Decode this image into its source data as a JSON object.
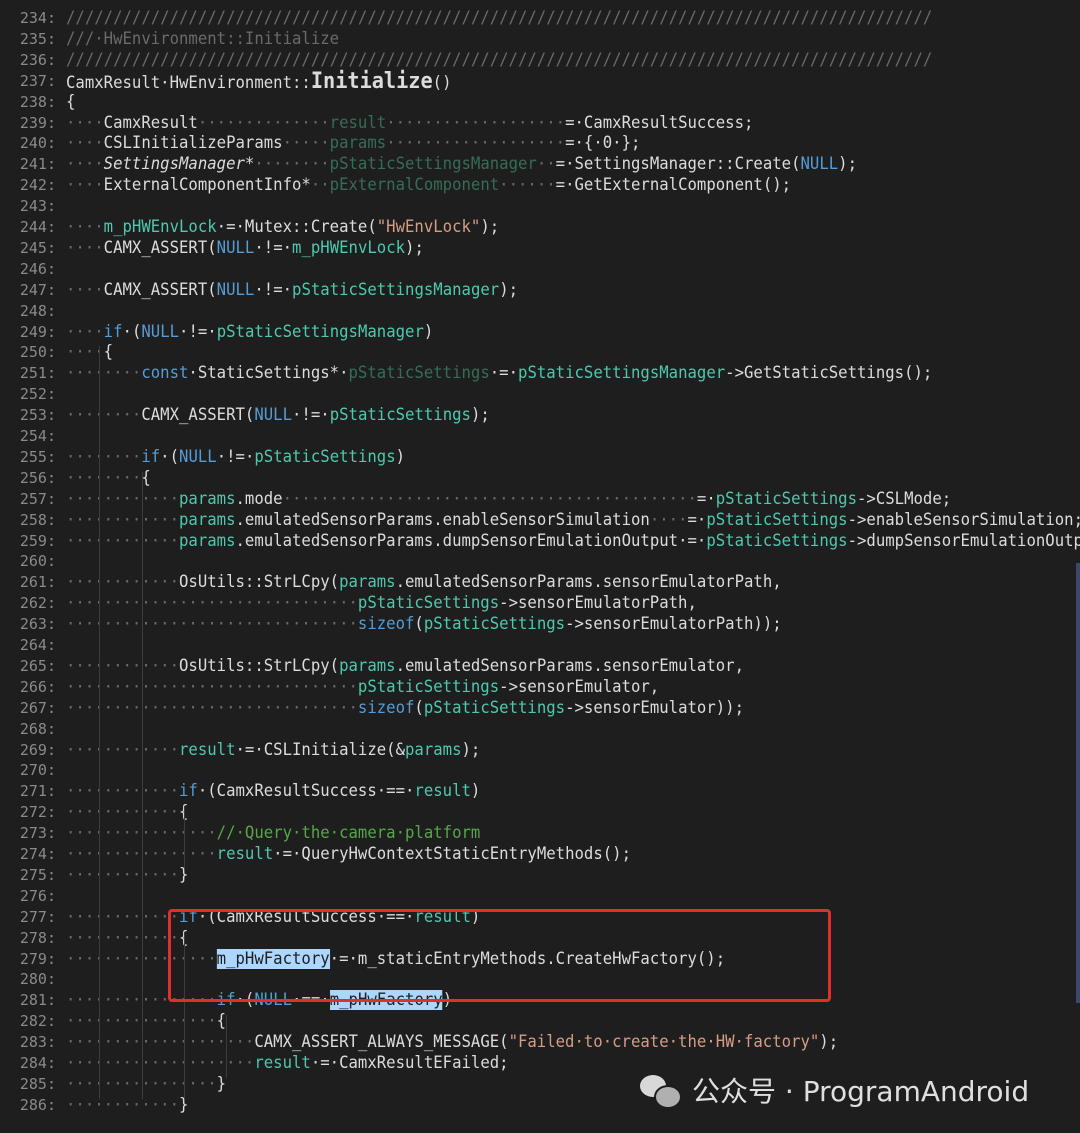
{
  "watermark": {
    "text": "公众号 · ProgramAndroid",
    "icon": "wechat-icon"
  },
  "lines": [
    {
      "n": "234:",
      "s": [
        [
          "dot",
          "////////////////////////////////////////////////////////////////////////////////////////////"
        ]
      ]
    },
    {
      "n": "235:",
      "s": [
        [
          "dot",
          "///·HwEnvironment::Initialize"
        ]
      ]
    },
    {
      "n": "236:",
      "s": [
        [
          "dot",
          "////////////////////////////////////////////////////////////////////////////////////////////"
        ]
      ]
    },
    {
      "n": "237:",
      "s": [
        [
          "plain",
          "CamxResult·HwEnvironment::"
        ],
        [
          "fn",
          "Initialize"
        ],
        [
          "plain",
          "()"
        ]
      ]
    },
    {
      "n": "238:",
      "s": [
        [
          "plain",
          "{"
        ]
      ]
    },
    {
      "n": "239:",
      "s": [
        [
          "dot",
          "····"
        ],
        [
          "plain",
          "CamxResult"
        ],
        [
          "dot",
          "··············"
        ],
        [
          "gray",
          "result"
        ],
        [
          "dot",
          "···················"
        ],
        [
          "plain",
          "=·CamxResultSuccess;"
        ]
      ]
    },
    {
      "n": "240:",
      "s": [
        [
          "dot",
          "····"
        ],
        [
          "plain",
          "CSLInitializeParams"
        ],
        [
          "dot",
          "·····"
        ],
        [
          "gray",
          "params"
        ],
        [
          "dot",
          "···················"
        ],
        [
          "plain",
          "=·{·0·};"
        ]
      ]
    },
    {
      "n": "241:",
      "s": [
        [
          "dot",
          "····"
        ],
        [
          "it",
          "SettingsManager*"
        ],
        [
          "dot",
          "········"
        ],
        [
          "gray",
          "pStaticSettingsManager"
        ],
        [
          "dot",
          "··"
        ],
        [
          "plain",
          "=·SettingsManager::Create("
        ],
        [
          "kw",
          "NULL"
        ],
        [
          "plain",
          ");"
        ]
      ]
    },
    {
      "n": "242:",
      "s": [
        [
          "dot",
          "····"
        ],
        [
          "plain",
          "ExternalComponentInfo*"
        ],
        [
          "dot",
          "··"
        ],
        [
          "gray",
          "pExternalComponent"
        ],
        [
          "dot",
          "······"
        ],
        [
          "plain",
          "=·GetExternalComponent();"
        ]
      ]
    },
    {
      "n": "243:",
      "s": []
    },
    {
      "n": "244:",
      "s": [
        [
          "dot",
          "····"
        ],
        [
          "var",
          "m_pHWEnvLock"
        ],
        [
          "plain",
          "·=·Mutex::Create("
        ],
        [
          "str",
          "\"HwEnvLock\""
        ],
        [
          "plain",
          ");"
        ]
      ]
    },
    {
      "n": "245:",
      "s": [
        [
          "dot",
          "····"
        ],
        [
          "plain",
          "CAMX_ASSERT("
        ],
        [
          "kw",
          "NULL"
        ],
        [
          "plain",
          "·!=·"
        ],
        [
          "var",
          "m_pHWEnvLock"
        ],
        [
          "plain",
          ");"
        ]
      ]
    },
    {
      "n": "246:",
      "s": []
    },
    {
      "n": "247:",
      "s": [
        [
          "dot",
          "····"
        ],
        [
          "plain",
          "CAMX_ASSERT("
        ],
        [
          "kw",
          "NULL"
        ],
        [
          "plain",
          "·!=·"
        ],
        [
          "var",
          "pStaticSettingsManager"
        ],
        [
          "plain",
          ");"
        ]
      ]
    },
    {
      "n": "248:",
      "s": []
    },
    {
      "n": "249:",
      "s": [
        [
          "dot",
          "····"
        ],
        [
          "kw",
          "if"
        ],
        [
          "plain",
          "·("
        ],
        [
          "kw",
          "NULL"
        ],
        [
          "plain",
          "·!=·"
        ],
        [
          "var",
          "pStaticSettingsManager"
        ],
        [
          "plain",
          ")"
        ]
      ]
    },
    {
      "n": "250:",
      "s": [
        [
          "dot",
          "····"
        ],
        [
          "plain",
          "{"
        ]
      ]
    },
    {
      "n": "251:",
      "s": [
        [
          "dot",
          "········"
        ],
        [
          "kw",
          "const"
        ],
        [
          "plain",
          "·StaticSettings*·"
        ],
        [
          "gray",
          "pStaticSettings"
        ],
        [
          "plain",
          "·=·"
        ],
        [
          "var",
          "pStaticSettingsManager"
        ],
        [
          "plain",
          "->GetStaticSettings();"
        ]
      ]
    },
    {
      "n": "252:",
      "s": []
    },
    {
      "n": "253:",
      "s": [
        [
          "dot",
          "········"
        ],
        [
          "plain",
          "CAMX_ASSERT("
        ],
        [
          "kw",
          "NULL"
        ],
        [
          "plain",
          "·!=·"
        ],
        [
          "var",
          "pStaticSettings"
        ],
        [
          "plain",
          ");"
        ]
      ]
    },
    {
      "n": "254:",
      "s": []
    },
    {
      "n": "255:",
      "s": [
        [
          "dot",
          "········"
        ],
        [
          "kw",
          "if"
        ],
        [
          "plain",
          "·("
        ],
        [
          "kw",
          "NULL"
        ],
        [
          "plain",
          "·!=·"
        ],
        [
          "var",
          "pStaticSettings"
        ],
        [
          "plain",
          ")"
        ]
      ]
    },
    {
      "n": "256:",
      "s": [
        [
          "dot",
          "········"
        ],
        [
          "plain",
          "{"
        ]
      ]
    },
    {
      "n": "257:",
      "s": [
        [
          "dot",
          "············"
        ],
        [
          "var",
          "params"
        ],
        [
          "plain",
          ".mode"
        ],
        [
          "dot",
          "············································"
        ],
        [
          "plain",
          "=·"
        ],
        [
          "var",
          "pStaticSettings"
        ],
        [
          "plain",
          "->CSLMode;"
        ]
      ]
    },
    {
      "n": "258:",
      "s": [
        [
          "dot",
          "············"
        ],
        [
          "var",
          "params"
        ],
        [
          "plain",
          ".emulatedSensorParams.enableSensorSimulation"
        ],
        [
          "dot",
          "····"
        ],
        [
          "plain",
          "=·"
        ],
        [
          "var",
          "pStaticSettings"
        ],
        [
          "plain",
          "->enableSensorSimulation;"
        ]
      ]
    },
    {
      "n": "259:",
      "s": [
        [
          "dot",
          "············"
        ],
        [
          "var",
          "params"
        ],
        [
          "plain",
          ".emulatedSensorParams.dumpSensorEmulationOutput·=·"
        ],
        [
          "var",
          "pStaticSettings"
        ],
        [
          "plain",
          "->dumpSensorEmulationOutput;"
        ]
      ]
    },
    {
      "n": "260:",
      "s": []
    },
    {
      "n": "261:",
      "s": [
        [
          "dot",
          "············"
        ],
        [
          "plain",
          "OsUtils::StrLCpy("
        ],
        [
          "var",
          "params"
        ],
        [
          "plain",
          ".emulatedSensorParams.sensorEmulatorPath,"
        ]
      ]
    },
    {
      "n": "262:",
      "s": [
        [
          "dot",
          "·······························"
        ],
        [
          "var",
          "pStaticSettings"
        ],
        [
          "plain",
          "->sensorEmulatorPath,"
        ]
      ]
    },
    {
      "n": "263:",
      "s": [
        [
          "dot",
          "·······························"
        ],
        [
          "kw",
          "sizeof"
        ],
        [
          "plain",
          "("
        ],
        [
          "var",
          "pStaticSettings"
        ],
        [
          "plain",
          "->sensorEmulatorPath));"
        ]
      ]
    },
    {
      "n": "264:",
      "s": []
    },
    {
      "n": "265:",
      "s": [
        [
          "dot",
          "············"
        ],
        [
          "plain",
          "OsUtils::StrLCpy("
        ],
        [
          "var",
          "params"
        ],
        [
          "plain",
          ".emulatedSensorParams.sensorEmulator,"
        ]
      ]
    },
    {
      "n": "266:",
      "s": [
        [
          "dot",
          "·······························"
        ],
        [
          "var",
          "pStaticSettings"
        ],
        [
          "plain",
          "->sensorEmulator,"
        ]
      ]
    },
    {
      "n": "267:",
      "s": [
        [
          "dot",
          "·······························"
        ],
        [
          "kw",
          "sizeof"
        ],
        [
          "plain",
          "("
        ],
        [
          "var",
          "pStaticSettings"
        ],
        [
          "plain",
          "->sensorEmulator));"
        ]
      ]
    },
    {
      "n": "268:",
      "s": []
    },
    {
      "n": "269:",
      "s": [
        [
          "dot",
          "············"
        ],
        [
          "var",
          "result"
        ],
        [
          "plain",
          "·=·CSLInitialize(&"
        ],
        [
          "var",
          "params"
        ],
        [
          "plain",
          ");"
        ]
      ]
    },
    {
      "n": "270:",
      "s": []
    },
    {
      "n": "271:",
      "s": [
        [
          "dot",
          "············"
        ],
        [
          "kw",
          "if"
        ],
        [
          "plain",
          "·(CamxResultSuccess·==·"
        ],
        [
          "var",
          "result"
        ],
        [
          "plain",
          ")"
        ]
      ]
    },
    {
      "n": "272:",
      "s": [
        [
          "dot",
          "············"
        ],
        [
          "plain",
          "{"
        ]
      ]
    },
    {
      "n": "273:",
      "s": [
        [
          "dot",
          "················"
        ],
        [
          "cm",
          "//·Query·the·camera·platform"
        ]
      ]
    },
    {
      "n": "274:",
      "s": [
        [
          "dot",
          "················"
        ],
        [
          "var",
          "result"
        ],
        [
          "plain",
          "·=·QueryHwContextStaticEntryMethods();"
        ]
      ]
    },
    {
      "n": "275:",
      "s": [
        [
          "dot",
          "············"
        ],
        [
          "plain",
          "}"
        ]
      ]
    },
    {
      "n": "276:",
      "s": []
    },
    {
      "n": "277:",
      "s": [
        [
          "dot",
          "············"
        ],
        [
          "kw",
          "if"
        ],
        [
          "plain",
          "·(CamxResultSuccess·==·"
        ],
        [
          "var",
          "result"
        ],
        [
          "plain",
          ")"
        ]
      ]
    },
    {
      "n": "278:",
      "s": [
        [
          "dot",
          "············"
        ],
        [
          "plain",
          "{"
        ]
      ]
    },
    {
      "n": "279:",
      "s": [
        [
          "dot",
          "················"
        ],
        [
          "sel",
          "m_pHwFactory"
        ],
        [
          "plain",
          "·=·m_staticEntryMethods.CreateHwFactory();"
        ]
      ]
    },
    {
      "n": "280:",
      "s": []
    },
    {
      "n": "281:",
      "s": [
        [
          "dot",
          "················"
        ],
        [
          "kw",
          "if"
        ],
        [
          "plain",
          "·("
        ],
        [
          "kw",
          "NULL"
        ],
        [
          "plain",
          "·==·"
        ],
        [
          "sel",
          "m_pHwFactory"
        ],
        [
          "plain",
          ")"
        ]
      ]
    },
    {
      "n": "282:",
      "s": [
        [
          "dot",
          "················"
        ],
        [
          "plain",
          "{"
        ]
      ]
    },
    {
      "n": "283:",
      "s": [
        [
          "dot",
          "····················"
        ],
        [
          "plain",
          "CAMX_ASSERT_ALWAYS_MESSAGE("
        ],
        [
          "str",
          "\"Failed·to·create·the·HW·factory\""
        ],
        [
          "plain",
          ");"
        ]
      ]
    },
    {
      "n": "284:",
      "s": [
        [
          "dot",
          "····················"
        ],
        [
          "var",
          "result"
        ],
        [
          "plain",
          "·=·CamxResultEFailed;"
        ]
      ]
    },
    {
      "n": "285:",
      "s": [
        [
          "dot",
          "················"
        ],
        [
          "plain",
          "}"
        ]
      ]
    },
    {
      "n": "286:",
      "s": [
        [
          "dot",
          "············"
        ],
        [
          "plain",
          "}"
        ]
      ]
    }
  ]
}
